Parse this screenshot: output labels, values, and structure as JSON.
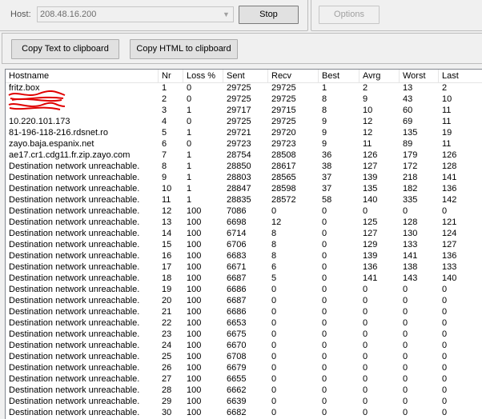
{
  "toolbar": {
    "host_label": "Host:",
    "host_value": "208.48.16.200",
    "stop_label": "Stop",
    "options_label": "Options",
    "copy_text_label": "Copy Text to clipboard",
    "copy_html_label": "Copy HTML to clipboard"
  },
  "table": {
    "columns": [
      "Hostname",
      "Nr",
      "Loss %",
      "Sent",
      "Recv",
      "Best",
      "Avrg",
      "Worst",
      "Last"
    ],
    "rows": [
      [
        "fritz.box",
        "1",
        "0",
        "29725",
        "29725",
        "1",
        "2",
        "13",
        "2"
      ],
      [
        "",
        "2",
        "0",
        "29725",
        "29725",
        "8",
        "9",
        "43",
        "10"
      ],
      [
        "",
        "3",
        "1",
        "29717",
        "29715",
        "8",
        "10",
        "60",
        "11"
      ],
      [
        "10.220.101.173",
        "4",
        "0",
        "29725",
        "29725",
        "9",
        "12",
        "69",
        "11"
      ],
      [
        "81-196-118-216.rdsnet.ro",
        "5",
        "1",
        "29721",
        "29720",
        "9",
        "12",
        "135",
        "19"
      ],
      [
        "zayo.baja.espanix.net",
        "6",
        "0",
        "29723",
        "29723",
        "9",
        "11",
        "89",
        "11"
      ],
      [
        "ae17.cr1.cdg11.fr.zip.zayo.com",
        "7",
        "1",
        "28754",
        "28508",
        "36",
        "126",
        "179",
        "126"
      ],
      [
        "Destination network unreachable.",
        "8",
        "1",
        "28850",
        "28617",
        "38",
        "127",
        "172",
        "128"
      ],
      [
        "Destination network unreachable.",
        "9",
        "1",
        "28803",
        "28565",
        "37",
        "139",
        "218",
        "141"
      ],
      [
        "Destination network unreachable.",
        "10",
        "1",
        "28847",
        "28598",
        "37",
        "135",
        "182",
        "136"
      ],
      [
        "Destination network unreachable.",
        "11",
        "1",
        "28835",
        "28572",
        "58",
        "140",
        "335",
        "142"
      ],
      [
        "Destination network unreachable.",
        "12",
        "100",
        "7086",
        "0",
        "0",
        "0",
        "0",
        "0"
      ],
      [
        "Destination network unreachable.",
        "13",
        "100",
        "6698",
        "12",
        "0",
        "125",
        "128",
        "121"
      ],
      [
        "Destination network unreachable.",
        "14",
        "100",
        "6714",
        "8",
        "0",
        "127",
        "130",
        "124"
      ],
      [
        "Destination network unreachable.",
        "15",
        "100",
        "6706",
        "8",
        "0",
        "129",
        "133",
        "127"
      ],
      [
        "Destination network unreachable.",
        "16",
        "100",
        "6683",
        "8",
        "0",
        "139",
        "141",
        "136"
      ],
      [
        "Destination network unreachable.",
        "17",
        "100",
        "6671",
        "6",
        "0",
        "136",
        "138",
        "133"
      ],
      [
        "Destination network unreachable.",
        "18",
        "100",
        "6687",
        "5",
        "0",
        "141",
        "143",
        "140"
      ],
      [
        "Destination network unreachable.",
        "19",
        "100",
        "6686",
        "0",
        "0",
        "0",
        "0",
        "0"
      ],
      [
        "Destination network unreachable.",
        "20",
        "100",
        "6687",
        "0",
        "0",
        "0",
        "0",
        "0"
      ],
      [
        "Destination network unreachable.",
        "21",
        "100",
        "6686",
        "0",
        "0",
        "0",
        "0",
        "0"
      ],
      [
        "Destination network unreachable.",
        "22",
        "100",
        "6653",
        "0",
        "0",
        "0",
        "0",
        "0"
      ],
      [
        "Destination network unreachable.",
        "23",
        "100",
        "6675",
        "0",
        "0",
        "0",
        "0",
        "0"
      ],
      [
        "Destination network unreachable.",
        "24",
        "100",
        "6670",
        "0",
        "0",
        "0",
        "0",
        "0"
      ],
      [
        "Destination network unreachable.",
        "25",
        "100",
        "6708",
        "0",
        "0",
        "0",
        "0",
        "0"
      ],
      [
        "Destination network unreachable.",
        "26",
        "100",
        "6679",
        "0",
        "0",
        "0",
        "0",
        "0"
      ],
      [
        "Destination network unreachable.",
        "27",
        "100",
        "6655",
        "0",
        "0",
        "0",
        "0",
        "0"
      ],
      [
        "Destination network unreachable.",
        "28",
        "100",
        "6662",
        "0",
        "0",
        "0",
        "0",
        "0"
      ],
      [
        "Destination network unreachable.",
        "29",
        "100",
        "6639",
        "0",
        "0",
        "0",
        "0",
        "0"
      ],
      [
        "Destination network unreachable.",
        "30",
        "100",
        "6682",
        "0",
        "0",
        "0",
        "0",
        "0"
      ]
    ]
  },
  "redaction_color": "#e00000",
  "icons": {
    "combo_dropdown": "chevron-down-icon"
  }
}
